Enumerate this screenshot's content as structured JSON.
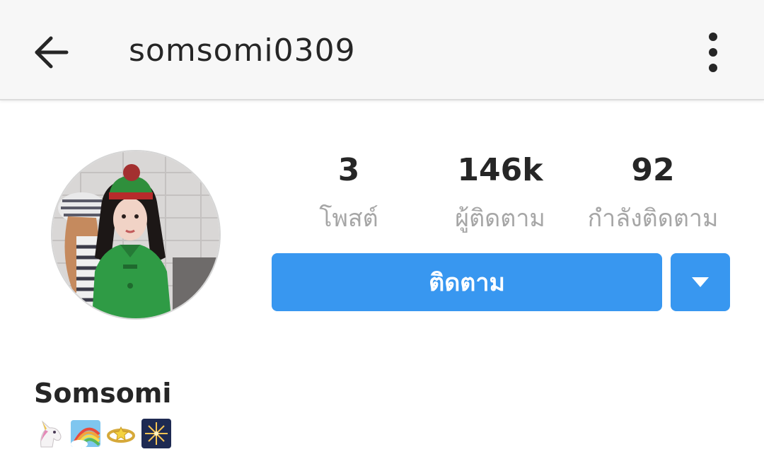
{
  "header": {
    "username": "somsomi0309",
    "back_icon": "back-arrow-icon",
    "menu_icon": "more-vertical-icon"
  },
  "profile": {
    "avatar_icon": "profile-photo",
    "display_name": "Somsomi",
    "bio_emojis": [
      "unicorn-emoji",
      "rainbow-emoji",
      "ring-emoji",
      "fireworks-emoji"
    ]
  },
  "stats": [
    {
      "count": "3",
      "label": "โพสต์"
    },
    {
      "count": "146k",
      "label": "ผู้ติดตาม"
    },
    {
      "count": "92",
      "label": "กำลังติดตาม"
    }
  ],
  "actions": {
    "follow_label": "ติดตาม",
    "dropdown_icon": "triangle-down-icon"
  },
  "colors": {
    "accent": "#3897f0",
    "header_bg": "#f7f7f7",
    "label_gray": "#a6a6a6",
    "text": "#262626"
  }
}
